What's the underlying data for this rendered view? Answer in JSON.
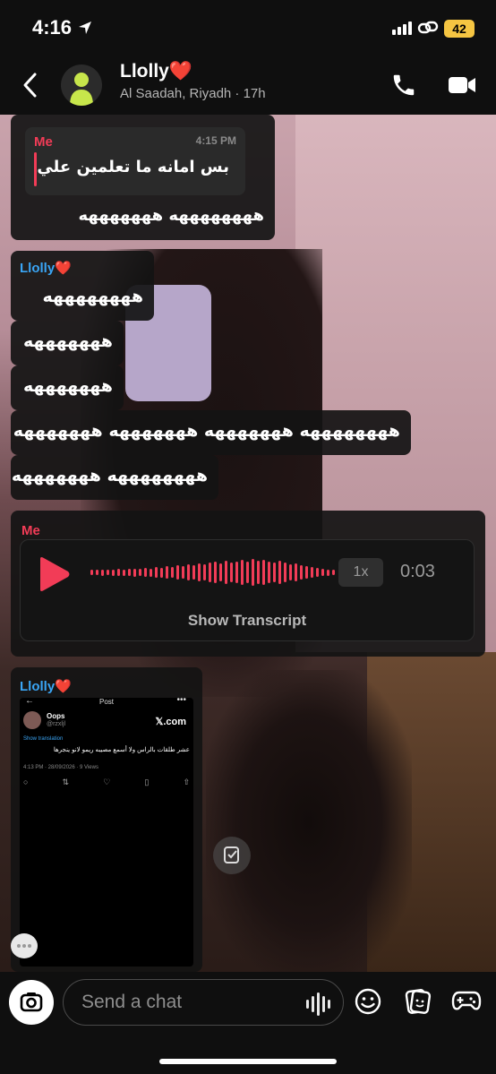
{
  "status_bar": {
    "time": "4:16",
    "battery": "42"
  },
  "header": {
    "contact_name": "Llolly❤️",
    "subtitle": "Al Saadah, Riyadh · 17h"
  },
  "messages": {
    "m1": {
      "quote_sender": "Me",
      "quote_time": "4:15 PM",
      "quote_text": "بس امانه ما تعلمين علي",
      "text": "ههههههههه هههههههه"
    },
    "m2": {
      "sender": "Llolly❤️",
      "lines": [
        "ههههههههه",
        "هههههههه",
        "هههههههه",
        "ههههههههه هههههههه هههههههه هههههههه",
        "ههههههههه هههههههه"
      ]
    },
    "m3": {
      "sender": "Me",
      "speed": "1x",
      "duration": "0:03",
      "transcript_label": "Show Transcript"
    },
    "m4": {
      "sender": "Llolly❤️",
      "post": {
        "title": "Post",
        "author": "Oops",
        "handle": "@rzxljl",
        "source": "𝕏.com",
        "translation_link": "Show translation",
        "text": "عشر طلقات بالراس ولا أسمع مصيبه ريمو لانو ينجرها",
        "meta": "4:13 PM · 28/09/2026 · 9 Views"
      }
    }
  },
  "composer": {
    "placeholder": "Send a chat"
  },
  "colors": {
    "me": "#f23c57",
    "them": "#3aa5f5",
    "bubble": "#141414"
  },
  "icons": [
    "location-arrow-icon",
    "signal-icon",
    "link-icon",
    "back-chevron-icon",
    "phone-icon",
    "video-icon",
    "play-icon",
    "save-icon",
    "typing-icon",
    "camera-icon",
    "mic-icon",
    "emoji-icon",
    "sticker-icon",
    "game-icon"
  ]
}
